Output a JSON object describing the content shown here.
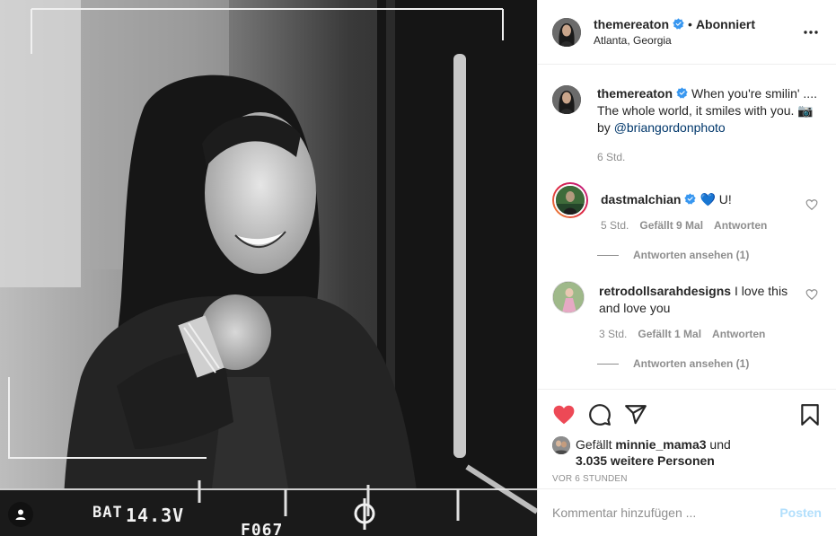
{
  "colors": {
    "verified": "#3897f0",
    "like_red": "#ed4956",
    "link": "#00376b",
    "post_disabled": "#b2dffc",
    "muted": "#8e8e8e"
  },
  "photo": {
    "hud_battery": "BAT",
    "hud_voltage": "14.3V",
    "hud_aperture": "F067",
    "user_tag_icon": "user-silhouette-icon"
  },
  "header": {
    "username": "themereaton",
    "separator": "•",
    "follow_state": "Abonniert",
    "location": "Atlanta, Georgia",
    "more_icon": "more-horizontal-icon"
  },
  "caption": {
    "username": "themereaton",
    "text": "When you're smilin' .... The whole world, it smiles with you. 📷 by ",
    "mention": "@briangordonphoto",
    "time": "6 Std."
  },
  "comments": [
    {
      "username": "dastmalchian",
      "text": "💙 U!",
      "time": "5 Std.",
      "likes": "Gefällt 9 Mal",
      "reply": "Antworten",
      "view_replies": "Antworten ansehen (1)"
    },
    {
      "username": "retrodollsarahdesigns",
      "text": "I love this and love you",
      "time": "3 Std.",
      "likes": "Gefällt 1 Mal",
      "reply": "Antworten",
      "view_replies": "Antworten ansehen (1)"
    }
  ],
  "actions": {
    "liked": true,
    "liked_by_prefix": "Gefällt",
    "liked_by_user": "minnie_mama3",
    "liked_by_joiner": "und",
    "liked_by_others": "3.035 weitere Personen",
    "timestamp": "VOR 6 STUNDEN"
  },
  "add_comment": {
    "placeholder": "Kommentar hinzufügen ...",
    "post_label": "Posten"
  }
}
